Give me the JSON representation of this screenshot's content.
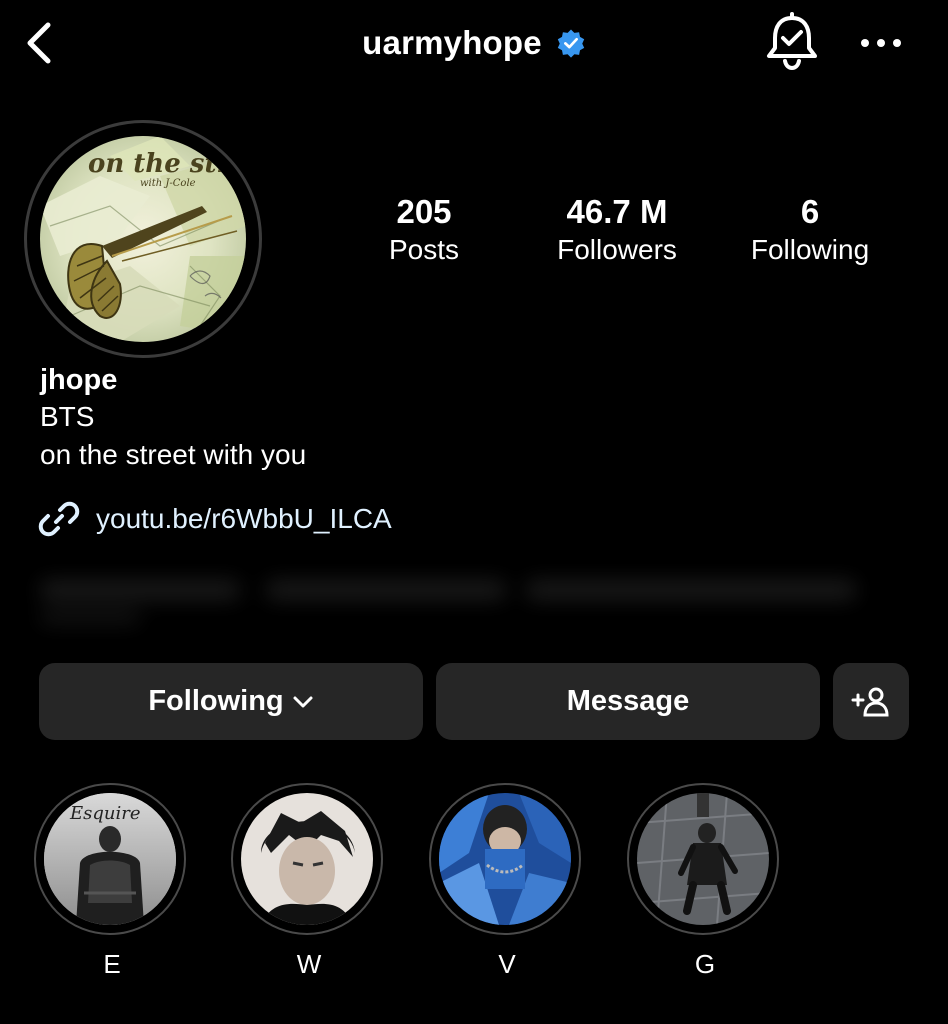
{
  "header": {
    "username": "uarmyhope",
    "verified": true,
    "back_icon": "chevron-left-icon",
    "bell_icon": "bell-check-icon",
    "more_icon": "more-horizontal-icon",
    "verified_color": "#3897f0"
  },
  "profile": {
    "avatar_text": "on the street",
    "avatar_subtext": "with J-Cole",
    "stats": [
      {
        "value": "205",
        "label": "Posts"
      },
      {
        "value": "46.7 M",
        "label": "Followers"
      },
      {
        "value": "6",
        "label": "Following"
      }
    ],
    "name": "jhope",
    "bio_lines": [
      "BTS",
      "on the street with you"
    ],
    "link": "youtu.be/r6WbbU_ILCA",
    "link_icon": "link-icon"
  },
  "actions": {
    "following_label": "Following",
    "following_icon": "chevron-down-icon",
    "message_label": "Message",
    "add_user_icon": "add-user-icon"
  },
  "highlights": [
    {
      "label": "E",
      "avatar_caption": "Esquire"
    },
    {
      "label": "W"
    },
    {
      "label": "V"
    },
    {
      "label": "G"
    }
  ],
  "colors": {
    "background": "#000000",
    "button": "#262626",
    "link": "#e0f1ff",
    "text": "#ffffff"
  }
}
